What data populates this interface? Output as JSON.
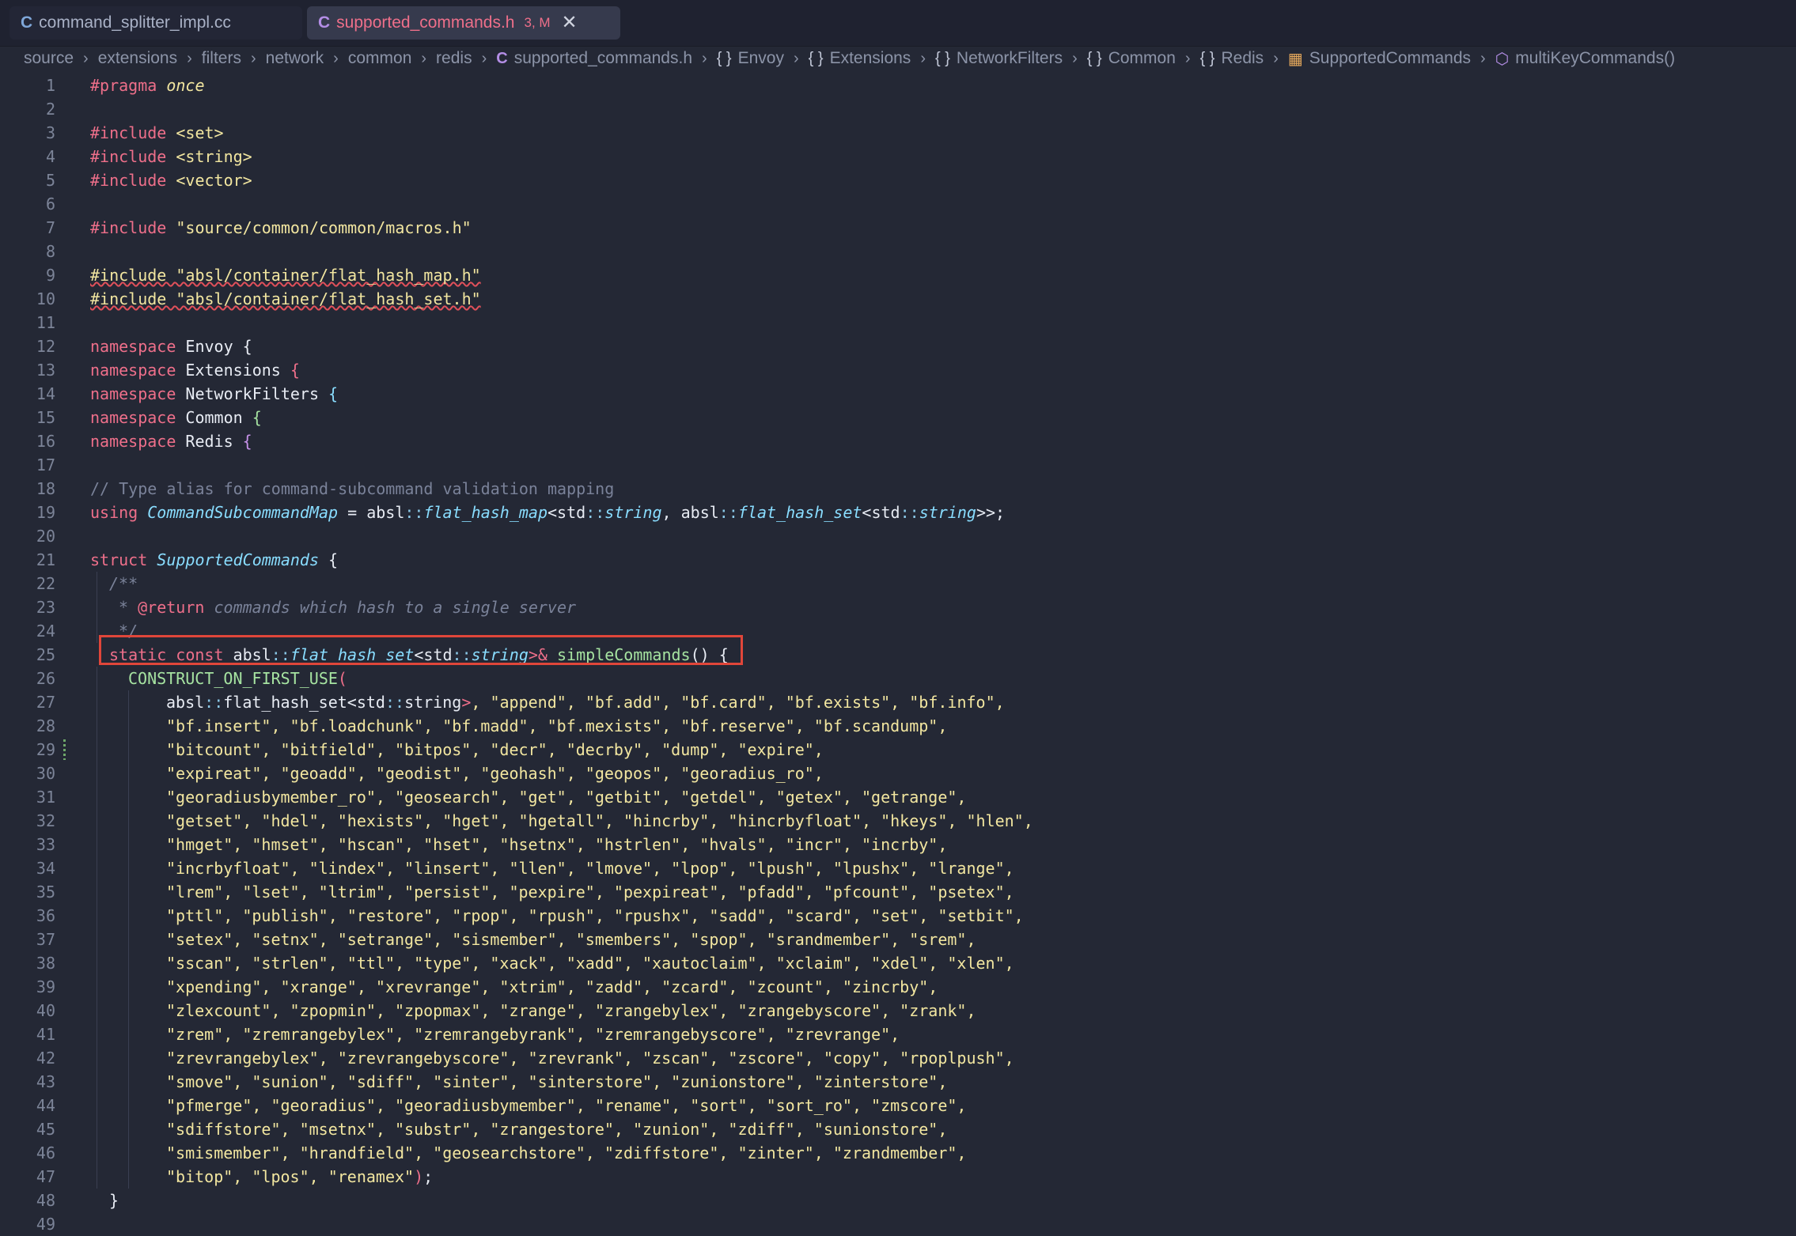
{
  "tabs": [
    {
      "icon": "C",
      "label": "command_splitter_impl.cc",
      "active": false
    },
    {
      "icon": "C",
      "label": "supported_commands.h",
      "badge": "3, M",
      "active": true
    }
  ],
  "breadcrumb": [
    "source",
    "extensions",
    "filters",
    "network",
    "common",
    "redis",
    "supported_commands.h",
    "Envoy",
    "Extensions",
    "NetworkFilters",
    "Common",
    "Redis",
    "SupportedCommands",
    "multiKeyCommands()"
  ],
  "code": {
    "l1a": "#pragma ",
    "l1b": "once",
    "l3a": "#include ",
    "l3b": "<set>",
    "l4a": "#include ",
    "l4b": "<string>",
    "l5a": "#include ",
    "l5b": "<vector>",
    "l7a": "#include ",
    "l7b": "\"source/common/common/macros.h\"",
    "l9": "#include \"absl/container/flat_hash_map.h\"",
    "l10": "#include \"absl/container/flat_hash_set.h\"",
    "l12": [
      "namespace",
      " Envoy ",
      "{"
    ],
    "l13": [
      "namespace",
      " Extensions ",
      "{"
    ],
    "l14": [
      "namespace",
      " NetworkFilters ",
      "{"
    ],
    "l15": [
      "namespace",
      " Common ",
      "{"
    ],
    "l16": [
      "namespace",
      " Redis ",
      "{"
    ],
    "l18": "// Type alias for command-subcommand validation mapping",
    "l19": [
      "using ",
      "CommandSubcommandMap",
      " = absl",
      "::",
      "flat_hash_map",
      "<std",
      "::",
      "string",
      ", absl",
      "::",
      "flat_hash_set",
      "<std",
      "::",
      "string",
      ">>;"
    ],
    "l21": [
      "struct ",
      "SupportedCommands",
      " {"
    ],
    "l22": "/**",
    "l23a": " * ",
    "l23b": "@return",
    "l23c": " commands which hash to a single server",
    "l24": " */",
    "l25": [
      "static ",
      "const ",
      "absl",
      "::",
      "flat_hash_set",
      "<std",
      "::",
      "string",
      ">& ",
      "simpleCommands",
      "() {"
    ],
    "l26": [
      "CONSTRUCT_ON_FIRST_USE",
      "("
    ],
    "l27": [
      "absl",
      "::",
      "flat_hash_set<std",
      "::",
      "string",
      ">",
      ", \"append\", \"bf.add\", \"bf.card\", \"bf.exists\", \"bf.info\","
    ],
    "l28": "\"bf.insert\", \"bf.loadchunk\", \"bf.madd\", \"bf.mexists\", \"bf.reserve\", \"bf.scandump\",",
    "l29": "\"bitcount\", \"bitfield\", \"bitpos\", \"decr\", \"decrby\", \"dump\", \"expire\",",
    "l30": "\"expireat\", \"geoadd\", \"geodist\", \"geohash\", \"geopos\", \"georadius_ro\",",
    "l31": "\"georadiusbymember_ro\", \"geosearch\", \"get\", \"getbit\", \"getdel\", \"getex\", \"getrange\",",
    "l32": "\"getset\", \"hdel\", \"hexists\", \"hget\", \"hgetall\", \"hincrby\", \"hincrbyfloat\", \"hkeys\", \"hlen\",",
    "l33": "\"hmget\", \"hmset\", \"hscan\", \"hset\", \"hsetnx\", \"hstrlen\", \"hvals\", \"incr\", \"incrby\",",
    "l34": "\"incrbyfloat\", \"lindex\", \"linsert\", \"llen\", \"lmove\", \"lpop\", \"lpush\", \"lpushx\", \"lrange\",",
    "l35": "\"lrem\", \"lset\", \"ltrim\", \"persist\", \"pexpire\", \"pexpireat\", \"pfadd\", \"pfcount\", \"psetex\",",
    "l36": "\"pttl\", \"publish\", \"restore\", \"rpop\", \"rpush\", \"rpushx\", \"sadd\", \"scard\", \"set\", \"setbit\",",
    "l37": "\"setex\", \"setnx\", \"setrange\", \"sismember\", \"smembers\", \"spop\", \"srandmember\", \"srem\",",
    "l38": "\"sscan\", \"strlen\", \"ttl\", \"type\", \"xack\", \"xadd\", \"xautoclaim\", \"xclaim\", \"xdel\", \"xlen\",",
    "l39": "\"xpending\", \"xrange\", \"xrevrange\", \"xtrim\", \"zadd\", \"zcard\", \"zcount\", \"zincrby\",",
    "l40": "\"zlexcount\", \"zpopmin\", \"zpopmax\", \"zrange\", \"zrangebylex\", \"zrangebyscore\", \"zrank\",",
    "l41": "\"zrem\", \"zremrangebylex\", \"zremrangebyrank\", \"zremrangebyscore\", \"zrevrange\",",
    "l42": "\"zrevrangebylex\", \"zrevrangebyscore\", \"zrevrank\", \"zscan\", \"zscore\", \"copy\", \"rpoplpush\",",
    "l43": "\"smove\", \"sunion\", \"sdiff\", \"sinter\", \"sinterstore\", \"zunionstore\", \"zinterstore\",",
    "l44": "\"pfmerge\", \"georadius\", \"georadiusbymember\", \"rename\", \"sort\", \"sort_ro\", \"zmscore\",",
    "l45": "\"sdiffstore\", \"msetnx\", \"substr\", \"zrangestore\", \"zunion\", \"zdiff\", \"sunionstore\",",
    "l46": "\"smismember\", \"hrandfield\", \"geosearchstore\", \"zdiffstore\", \"zinter\", \"zrandmember\",",
    "l47": [
      "\"bitop\", \"lpos\", \"renamex\"",
      ")",
      ";"
    ],
    "l48": "}"
  },
  "line_numbers": [
    "1",
    "2",
    "3",
    "4",
    "5",
    "6",
    "7",
    "8",
    "9",
    "10",
    "11",
    "12",
    "13",
    "14",
    "15",
    "16",
    "17",
    "18",
    "19",
    "20",
    "21",
    "22",
    "23",
    "24",
    "25",
    "26",
    "27",
    "28",
    "29",
    "30",
    "31",
    "32",
    "33",
    "34",
    "35",
    "36",
    "37",
    "38",
    "39",
    "40",
    "41",
    "42",
    "43",
    "44",
    "45",
    "46",
    "47",
    "48",
    "49"
  ],
  "colors": {
    "accent_tab": "#ee6f8a",
    "highlight_box": "#e0463a",
    "background": "#242835"
  }
}
